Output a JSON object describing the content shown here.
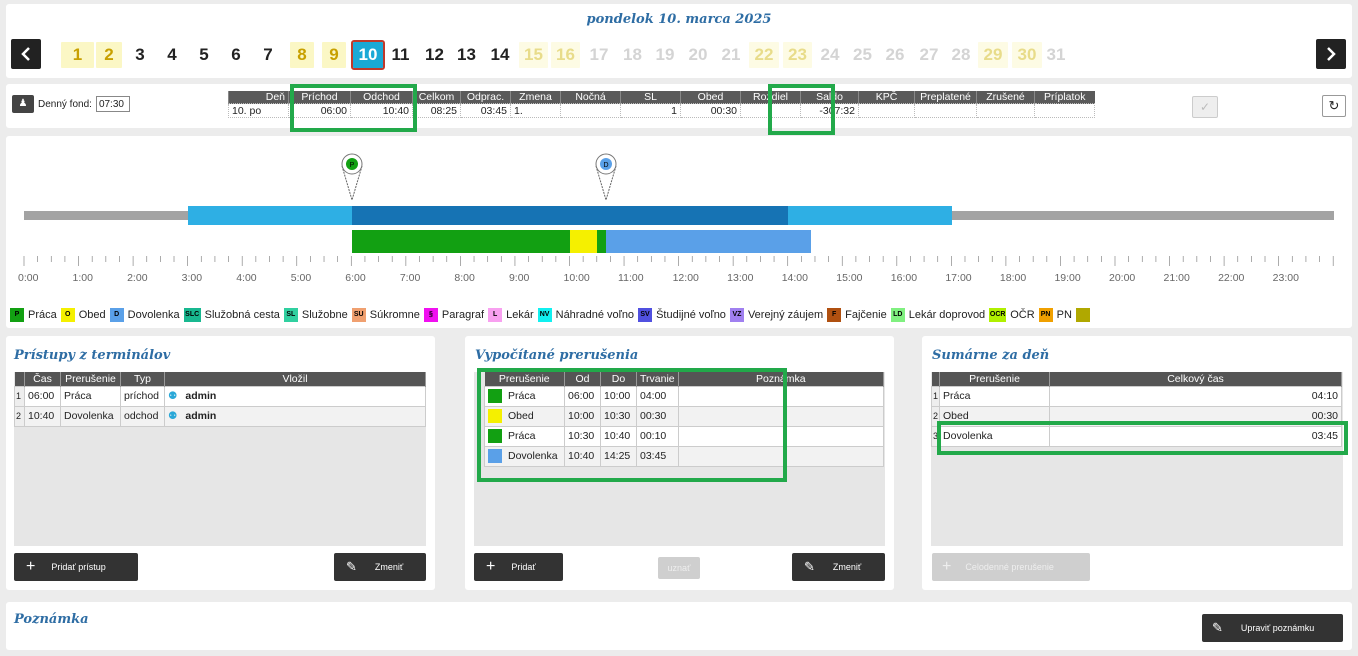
{
  "header": {
    "date_title": "pondelok 10. marca 2025"
  },
  "days": [
    {
      "n": "1",
      "t": "half"
    },
    {
      "n": "2",
      "t": "half"
    },
    {
      "n": "3",
      "t": "work"
    },
    {
      "n": "4",
      "t": "work"
    },
    {
      "n": "5",
      "t": "work"
    },
    {
      "n": "6",
      "t": "work"
    },
    {
      "n": "7",
      "t": "work"
    },
    {
      "n": "8",
      "t": "half"
    },
    {
      "n": "9",
      "t": "half"
    },
    {
      "n": "10",
      "t": "cur"
    },
    {
      "n": "11",
      "t": "work"
    },
    {
      "n": "12",
      "t": "work"
    },
    {
      "n": "13",
      "t": "work"
    },
    {
      "n": "14",
      "t": "work"
    },
    {
      "n": "15",
      "t": "half-off"
    },
    {
      "n": "16",
      "t": "half-off"
    },
    {
      "n": "17",
      "t": "off"
    },
    {
      "n": "18",
      "t": "off"
    },
    {
      "n": "19",
      "t": "off"
    },
    {
      "n": "20",
      "t": "off"
    },
    {
      "n": "21",
      "t": "off"
    },
    {
      "n": "22",
      "t": "half-off"
    },
    {
      "n": "23",
      "t": "half-off"
    },
    {
      "n": "24",
      "t": "off"
    },
    {
      "n": "25",
      "t": "off"
    },
    {
      "n": "26",
      "t": "off"
    },
    {
      "n": "27",
      "t": "off"
    },
    {
      "n": "28",
      "t": "off"
    },
    {
      "n": "29",
      "t": "half-off"
    },
    {
      "n": "30",
      "t": "half-off"
    },
    {
      "n": "31",
      "t": "off"
    }
  ],
  "summary": {
    "denny_fond_label": "Denný fond:",
    "denny_fond_value": "07:30",
    "columns": [
      "Deň",
      "Príchod",
      "Odchod",
      "Celkom",
      "Odprac.",
      "Zmena",
      "Nočná",
      "SL",
      "Obed",
      "Rozdiel",
      "Saldo",
      "KPČ",
      "Preplatené",
      "Zrušené",
      "Príplatok"
    ],
    "values": [
      "10. po",
      "06:00",
      "10:40",
      "08:25",
      "03:45",
      "1.",
      "",
      "1",
      "00:30",
      "",
      "-307:32",
      "",
      "",
      "",
      ""
    ]
  },
  "timeline": {
    "hours": [
      "0:00",
      "1:00",
      "2:00",
      "3:00",
      "4:00",
      "5:00",
      "6:00",
      "7:00",
      "8:00",
      "9:00",
      "10:00",
      "11:00",
      "12:00",
      "13:00",
      "14:00",
      "15:00",
      "16:00",
      "17:00",
      "18:00",
      "19:00",
      "20:00",
      "21:00",
      "22:00",
      "23:00"
    ],
    "pin_in_label": "P",
    "pin_out_label": "D"
  },
  "legend": [
    {
      "code": "P",
      "label": "Práca",
      "color": "#12a012"
    },
    {
      "code": "O",
      "label": "Obed",
      "color": "#f5f000"
    },
    {
      "code": "D",
      "label": "Dovolenka",
      "color": "#5aa0e8"
    },
    {
      "code": "SLC",
      "label": "Služobná cesta",
      "color": "#18b890"
    },
    {
      "code": "SL",
      "label": "Služobne",
      "color": "#30d0a0"
    },
    {
      "code": "SU",
      "label": "Súkromne",
      "color": "#f0a070"
    },
    {
      "code": "§",
      "label": "Paragraf",
      "color": "#f010f0"
    },
    {
      "code": "L",
      "label": "Lekár",
      "color": "#f8a0f0"
    },
    {
      "code": "NV",
      "label": "Náhradné voľno",
      "color": "#10f0f0"
    },
    {
      "code": "SV",
      "label": "Študijné voľno",
      "color": "#5050e0"
    },
    {
      "code": "VZ",
      "label": "Verejný záujem",
      "color": "#a080f0"
    },
    {
      "code": "F",
      "label": "Fajčenie",
      "color": "#b05010"
    },
    {
      "code": "LD",
      "label": "Lekár doprovod",
      "color": "#80f080"
    },
    {
      "code": "OCR",
      "label": "OČR",
      "color": "#b0f000"
    },
    {
      "code": "PN",
      "label": "PN",
      "color": "#f0a000"
    },
    {
      "code": "",
      "label": "",
      "color": "#b0a800"
    }
  ],
  "pristupy": {
    "title": "Prístupy z terminálov",
    "columns": [
      "",
      "Čas",
      "Prerušenie",
      "Typ",
      "Vložil"
    ],
    "rows": [
      {
        "i": "1",
        "cas": "06:00",
        "prerusenie": "Práca",
        "typ": "príchod",
        "vlozil": "admin"
      },
      {
        "i": "2",
        "cas": "10:40",
        "prerusenie": "Dovolenka",
        "typ": "odchod",
        "vlozil": "admin"
      }
    ],
    "add_label": "Pridať prístup",
    "edit_label": "Zmeniť"
  },
  "vypocitane": {
    "title": "Vypočítané prerušenia",
    "columns": [
      "Prerušenie",
      "Od",
      "Do",
      "Trvanie",
      "Poznámka"
    ],
    "rows": [
      {
        "color": "#12a012",
        "prerusenie": "Práca",
        "od": "06:00",
        "do": "10:00",
        "trvanie": "04:00",
        "poznamka": ""
      },
      {
        "color": "#f5f000",
        "prerusenie": "Obed",
        "od": "10:00",
        "do": "10:30",
        "trvanie": "00:30",
        "poznamka": ""
      },
      {
        "color": "#12a012",
        "prerusenie": "Práca",
        "od": "10:30",
        "do": "10:40",
        "trvanie": "00:10",
        "poznamka": ""
      },
      {
        "color": "#5aa0e8",
        "prerusenie": "Dovolenka",
        "od": "10:40",
        "do": "14:25",
        "trvanie": "03:45",
        "poznamka": ""
      }
    ],
    "add_label": "Pridať",
    "uznat_label": "uznať",
    "edit_label": "Zmeniť"
  },
  "sumarne": {
    "title": "Sumárne za deň",
    "columns": [
      "",
      "Prerušenie",
      "Celkový čas"
    ],
    "rows": [
      {
        "i": "1",
        "prerusenie": "Práca",
        "cas": "04:10"
      },
      {
        "i": "2",
        "prerusenie": "Obed",
        "cas": "00:30"
      },
      {
        "i": "3",
        "prerusenie": "Dovolenka",
        "cas": "03:45"
      }
    ],
    "add_label": "Celodenné prerušenie"
  },
  "poznamka": {
    "title": "Poznámka",
    "edit_label": "Upraviť poznámku"
  }
}
